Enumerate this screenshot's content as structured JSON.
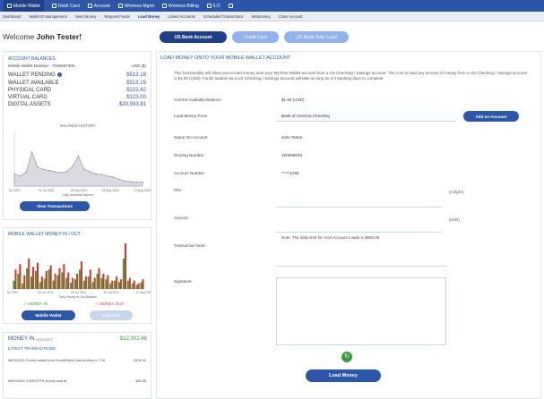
{
  "topnav": {
    "items": [
      {
        "label": "Mobile Wallet",
        "icon": "wallet-icon",
        "active": true
      },
      {
        "label": "Debit Card",
        "icon": "card-icon"
      },
      {
        "label": "Account",
        "icon": "user-icon"
      },
      {
        "label": "Wireless Mgmt",
        "icon": "wireless-icon"
      },
      {
        "label": "Wireless Billing",
        "icon": "billing-icon"
      },
      {
        "label": "ILD",
        "icon": "phone-icon"
      },
      {
        "label": "",
        "icon": "document-icon"
      }
    ]
  },
  "subnav": {
    "items": [
      {
        "label": "Dashboard"
      },
      {
        "label": "Wallet ID Management"
      },
      {
        "label": "Send Money"
      },
      {
        "label": "Request Funds"
      },
      {
        "label": "Load Money",
        "active": true
      },
      {
        "label": "Linked Accounts"
      },
      {
        "label": "Scheduled Transactions"
      },
      {
        "label": "Webmoney"
      },
      {
        "label": "Close Account"
      }
    ]
  },
  "welcome": {
    "prefix": "Welcome ",
    "name": "John Tester!"
  },
  "tabs": {
    "us_bank": "US Bank Account",
    "credit_card": "Credit Card",
    "teller_load": "US Bank Teller Load"
  },
  "balances": {
    "title": "ACCOUNT BALANCES",
    "wallet_number_label": "Mobile Wallet Number : 7546597305",
    "currency": "USD ($)",
    "pending_label": "WALLET PENDING",
    "pending_value": "$513.19",
    "available_label": "WALLET AVAILABLE",
    "available_value": "$513.19",
    "physical_label": "PHYSICAL CARD",
    "physical_value": "$222.42",
    "virtual_label": "VIRTUAL CARD",
    "virtual_value": "$123.00",
    "digital_label": "DIGITAL ASSETS",
    "digital_value": "$20,993.81",
    "view_transactions": "View Transactions"
  },
  "chart_data": [
    {
      "type": "area",
      "title": "BALANCE HISTORY",
      "xlabel": "Daily Available Balance",
      "ylabel": "",
      "x": [
        "Jul 2021",
        "31 Jul 2021",
        "15 Aug 2021",
        "28 Aug 2021",
        "11 Aug 2021"
      ],
      "series": [
        {
          "values": [
            22,
            18,
            25,
            62,
            34,
            30,
            28,
            26,
            24,
            26,
            36,
            54,
            30,
            26,
            22,
            21,
            18,
            16,
            12,
            9,
            8,
            7,
            7
          ]
        }
      ],
      "ylim": [
        0,
        100
      ],
      "grid": false
    },
    {
      "type": "bar",
      "title": "MOBILE WALLET MONEY IN / OUT",
      "xlabel": "Daily Money In-Out Balance",
      "x": [
        "Jul 2021",
        "18 Jul 2021",
        "28 Jul 2021",
        "22 Jul 2021",
        "17 Aug 2021"
      ],
      "series": [
        {
          "name": "MONEY IN",
          "color": "#3c9b3a",
          "values": [
            12,
            22,
            8,
            30,
            18,
            26,
            10,
            15,
            28,
            12,
            20,
            24,
            16,
            9,
            14,
            28,
            12,
            18,
            10,
            22,
            16,
            14,
            8,
            12,
            10,
            44,
            12,
            8,
            6,
            10
          ]
        },
        {
          "name": "MONEY OUT",
          "color": "#d23a2e",
          "values": [
            28,
            36,
            20,
            44,
            32,
            38,
            18,
            26,
            34,
            22,
            30,
            36,
            24,
            16,
            22,
            40,
            18,
            28,
            16,
            30,
            22,
            20,
            12,
            18,
            14,
            66,
            16,
            12,
            8,
            14
          ]
        }
      ],
      "ylim": [
        0,
        70
      ],
      "grid": false
    }
  ],
  "money_io": {
    "title": "MOBILE WALLET MONEY IN / OUT",
    "money_in": "MONEY IN",
    "money_out": "MONEY OUT",
    "mobile_wallet": "Mobile Wallet",
    "visa_card": "Visa Card"
  },
  "money_in": {
    "title": "MONEY IN",
    "month": "AUGUST",
    "amount": "$12,002.46",
    "latest": "LATEST TRANSACTIONS",
    "transactions": [
      {
        "date": "08/23/2021",
        "desc": "Funds loaded from Credit/Debit Card ending in 7718",
        "amount": "$100.00"
      },
      {
        "date": "08/20/2021",
        "desc": "0.0003 ETH (icons) sold at",
        "amount": "$45.35"
      }
    ]
  },
  "form": {
    "title": "LOAD MONEY ONTO YOUR MOBILE WALLET ACCOUNT",
    "description": "This functionality will allow you to load money onto your MyTime Wallet account from a US Checking / Savings account. The cost to load any amount of money from a US Checking / Savings account is $1.00 (USD). Funds loaded via a US Checking / Savings account will take as long as 3-4 banking days to complete.",
    "current_balance_label": "Current Available Balance",
    "current_balance_value": "$1.66 (USD)",
    "load_from_label": "Load Money From",
    "load_from_value": "Bank of America Checking",
    "add_account": "Add an Account",
    "name_label": "Name On Account",
    "name_value": "John Tester",
    "routing_label": "Routing Number",
    "routing_value": "100000023",
    "account_label": "Account Number",
    "account_value": "*****1238",
    "pin_label": "PIN",
    "pin_hint": "(4 digits)",
    "amount_label": "Amount",
    "amount_hint": "(USD)",
    "note": "Note:  The daily limit for ACH Account Loads is $500.00.",
    "tx_note_label": "Transaction Note",
    "signature_label": "Signature",
    "load_button": "Load Money"
  }
}
